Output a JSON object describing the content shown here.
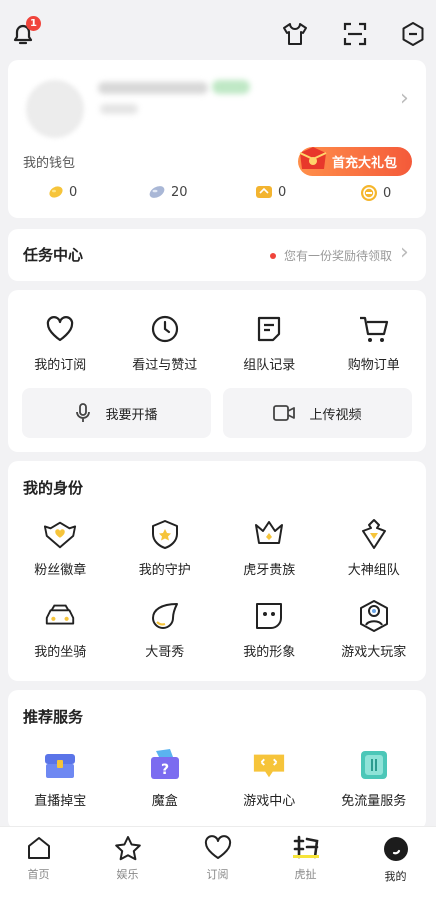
{
  "topbar": {
    "bell_badge": "1",
    "icons": [
      "bell-icon",
      "shirt-icon",
      "scan-icon",
      "settings-icon"
    ]
  },
  "profile": {
    "wallet_label": "我的钱包",
    "gift_button": "首充大礼包",
    "wallet": [
      {
        "icon": "gold-bean-icon",
        "value": "0"
      },
      {
        "icon": "silver-bean-icon",
        "value": "20"
      },
      {
        "icon": "coupon-icon",
        "value": "0"
      },
      {
        "icon": "coin-icon",
        "value": "0"
      }
    ]
  },
  "task_center": {
    "title": "任务中心",
    "reward_text": "您有一份奖励待领取"
  },
  "activity": {
    "items": [
      {
        "label": "我的订阅",
        "icon": "heart-icon"
      },
      {
        "label": "看过与赞过",
        "icon": "clock-icon"
      },
      {
        "label": "组队记录",
        "icon": "note-icon"
      },
      {
        "label": "购物订单",
        "icon": "cart-icon"
      }
    ],
    "live_button": "我要开播",
    "upload_button": "上传视频"
  },
  "identity": {
    "title": "我的身份",
    "items": [
      {
        "label": "粉丝徽章",
        "icon": "fan-badge-icon"
      },
      {
        "label": "我的守护",
        "icon": "guard-icon"
      },
      {
        "label": "虎牙贵族",
        "icon": "crown-icon"
      },
      {
        "label": "大神组队",
        "icon": "master-team-icon"
      },
      {
        "label": "我的坐骑",
        "icon": "car-icon"
      },
      {
        "label": "大哥秀",
        "icon": "bigbrother-icon"
      },
      {
        "label": "我的形象",
        "icon": "avatar-face-icon"
      },
      {
        "label": "游戏大玩家",
        "icon": "game-player-icon"
      }
    ]
  },
  "services": {
    "title": "推荐服务",
    "items": [
      {
        "label": "直播掉宝",
        "icon": "treasure-chest-icon"
      },
      {
        "label": "魔盒",
        "icon": "magic-box-icon"
      },
      {
        "label": "游戏中心",
        "icon": "game-center-icon"
      },
      {
        "label": "免流量服务",
        "icon": "free-data-icon"
      }
    ]
  },
  "bottom_nav": [
    {
      "label": "首页",
      "icon": "home-icon"
    },
    {
      "label": "娱乐",
      "icon": "star-icon"
    },
    {
      "label": "订阅",
      "icon": "heart-icon"
    },
    {
      "label": "虎扯",
      "icon": "huche-icon"
    },
    {
      "label": "我的",
      "icon": "me-icon"
    }
  ],
  "colors": {
    "accent_red": "#f0443b",
    "gift_orange": "#f45a3a"
  }
}
